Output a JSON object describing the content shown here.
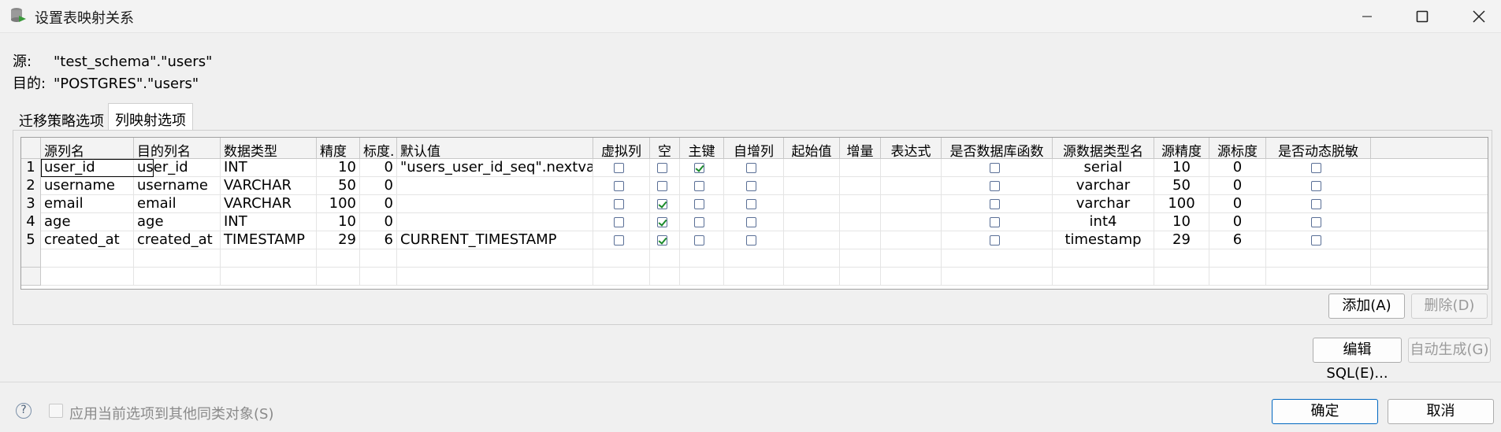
{
  "window": {
    "title": "设置表映射关系",
    "minimize_icon": "minimize-icon",
    "maximize_icon": "maximize-icon",
    "close_icon": "close-icon"
  },
  "info": {
    "source_label": "源:",
    "source_value": "\"test_schema\".\"users\"",
    "target_label": "目的:",
    "target_value": "\"POSTGRES\".\"users\""
  },
  "tabs": [
    {
      "label": "迁移策略选项",
      "active": false
    },
    {
      "label": "列映射选项",
      "active": true
    }
  ],
  "grid": {
    "columns": [
      "源列名",
      "目的列名",
      "数据类型",
      "精度",
      "标度.",
      "默认值",
      "虚拟列",
      "空",
      "主键",
      "自增列",
      "起始值",
      "增量",
      "表达式",
      "是否数据库函数",
      "源数据类型名",
      "源精度",
      "源标度",
      "是否动态脱敏"
    ],
    "rows": [
      {
        "n": "1",
        "src": "user_id",
        "dst": "user_id",
        "type": "INT",
        "prec": "10",
        "scale": "0",
        "default": "\"users_user_id_seq\".nextval",
        "virtual": false,
        "nullable": false,
        "pk": true,
        "auto": false,
        "start": "",
        "inc": "",
        "expr": "",
        "dbfunc": false,
        "srctype": "serial",
        "srcprec": "10",
        "srcscale": "0",
        "mask": false
      },
      {
        "n": "2",
        "src": "username",
        "dst": "username",
        "type": "VARCHAR",
        "prec": "50",
        "scale": "0",
        "default": "",
        "virtual": false,
        "nullable": false,
        "pk": false,
        "auto": false,
        "start": "",
        "inc": "",
        "expr": "",
        "dbfunc": false,
        "srctype": "varchar",
        "srcprec": "50",
        "srcscale": "0",
        "mask": false
      },
      {
        "n": "3",
        "src": "email",
        "dst": "email",
        "type": "VARCHAR",
        "prec": "100",
        "scale": "0",
        "default": "",
        "virtual": false,
        "nullable": true,
        "pk": false,
        "auto": false,
        "start": "",
        "inc": "",
        "expr": "",
        "dbfunc": false,
        "srctype": "varchar",
        "srcprec": "100",
        "srcscale": "0",
        "mask": false
      },
      {
        "n": "4",
        "src": "age",
        "dst": "age",
        "type": "INT",
        "prec": "10",
        "scale": "0",
        "default": "",
        "virtual": false,
        "nullable": true,
        "pk": false,
        "auto": false,
        "start": "",
        "inc": "",
        "expr": "",
        "dbfunc": false,
        "srctype": "int4",
        "srcprec": "10",
        "srcscale": "0",
        "mask": false
      },
      {
        "n": "5",
        "src": "created_at",
        "dst": "created_at",
        "type": "TIMESTAMP",
        "prec": "29",
        "scale": "6",
        "default": "CURRENT_TIMESTAMP",
        "virtual": false,
        "nullable": true,
        "pk": false,
        "auto": false,
        "start": "",
        "inc": "",
        "expr": "",
        "dbfunc": false,
        "srctype": "timestamp",
        "srcprec": "29",
        "srcscale": "6",
        "mask": false
      }
    ]
  },
  "buttons": {
    "add": "添加(A)",
    "delete": "删除(D)",
    "edit_sql": "编辑SQL(E)...",
    "auto_gen": "自动生成(G)",
    "ok": "确定",
    "cancel": "取消"
  },
  "footer": {
    "help_icon": "help-icon",
    "help_glyph": "?",
    "apply_label": "应用当前选项到其他同类对象(S)",
    "apply_checked": false
  }
}
